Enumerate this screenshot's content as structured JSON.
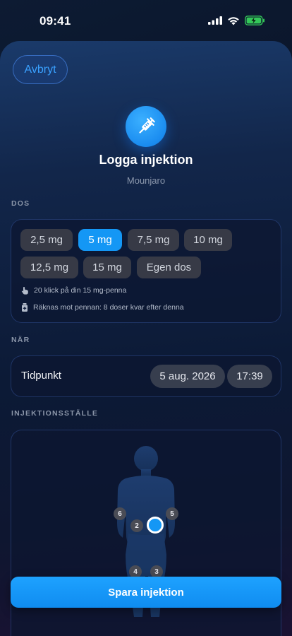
{
  "status": {
    "time": "09:41"
  },
  "header": {
    "cancel_label": "Avbryt",
    "title": "Logga injektion",
    "subtitle": "Mounjaro",
    "icon": "syringe-icon"
  },
  "dose": {
    "section_label": "DOS",
    "options": [
      "2,5 mg",
      "5 mg",
      "7,5 mg",
      "10 mg",
      "12,5 mg",
      "15 mg",
      "Egen dos"
    ],
    "selected": "5 mg",
    "clicks_info": "20 klick på din 15 mg-penna",
    "pen_info": "Räknas mot pennan: 8 doser kvar efter denna"
  },
  "when": {
    "section_label": "NÄR",
    "label": "Tidpunkt",
    "date": "5 aug. 2026",
    "time": "17:39"
  },
  "site": {
    "section_label": "INJEKTIONSSTÄLLE",
    "markers": [
      "6",
      "2",
      "5",
      "4",
      "3"
    ]
  },
  "footer": {
    "save_label": "Spara injektion"
  },
  "colors": {
    "accent": "#1497f5",
    "cancel_text": "#3aa0ff"
  }
}
